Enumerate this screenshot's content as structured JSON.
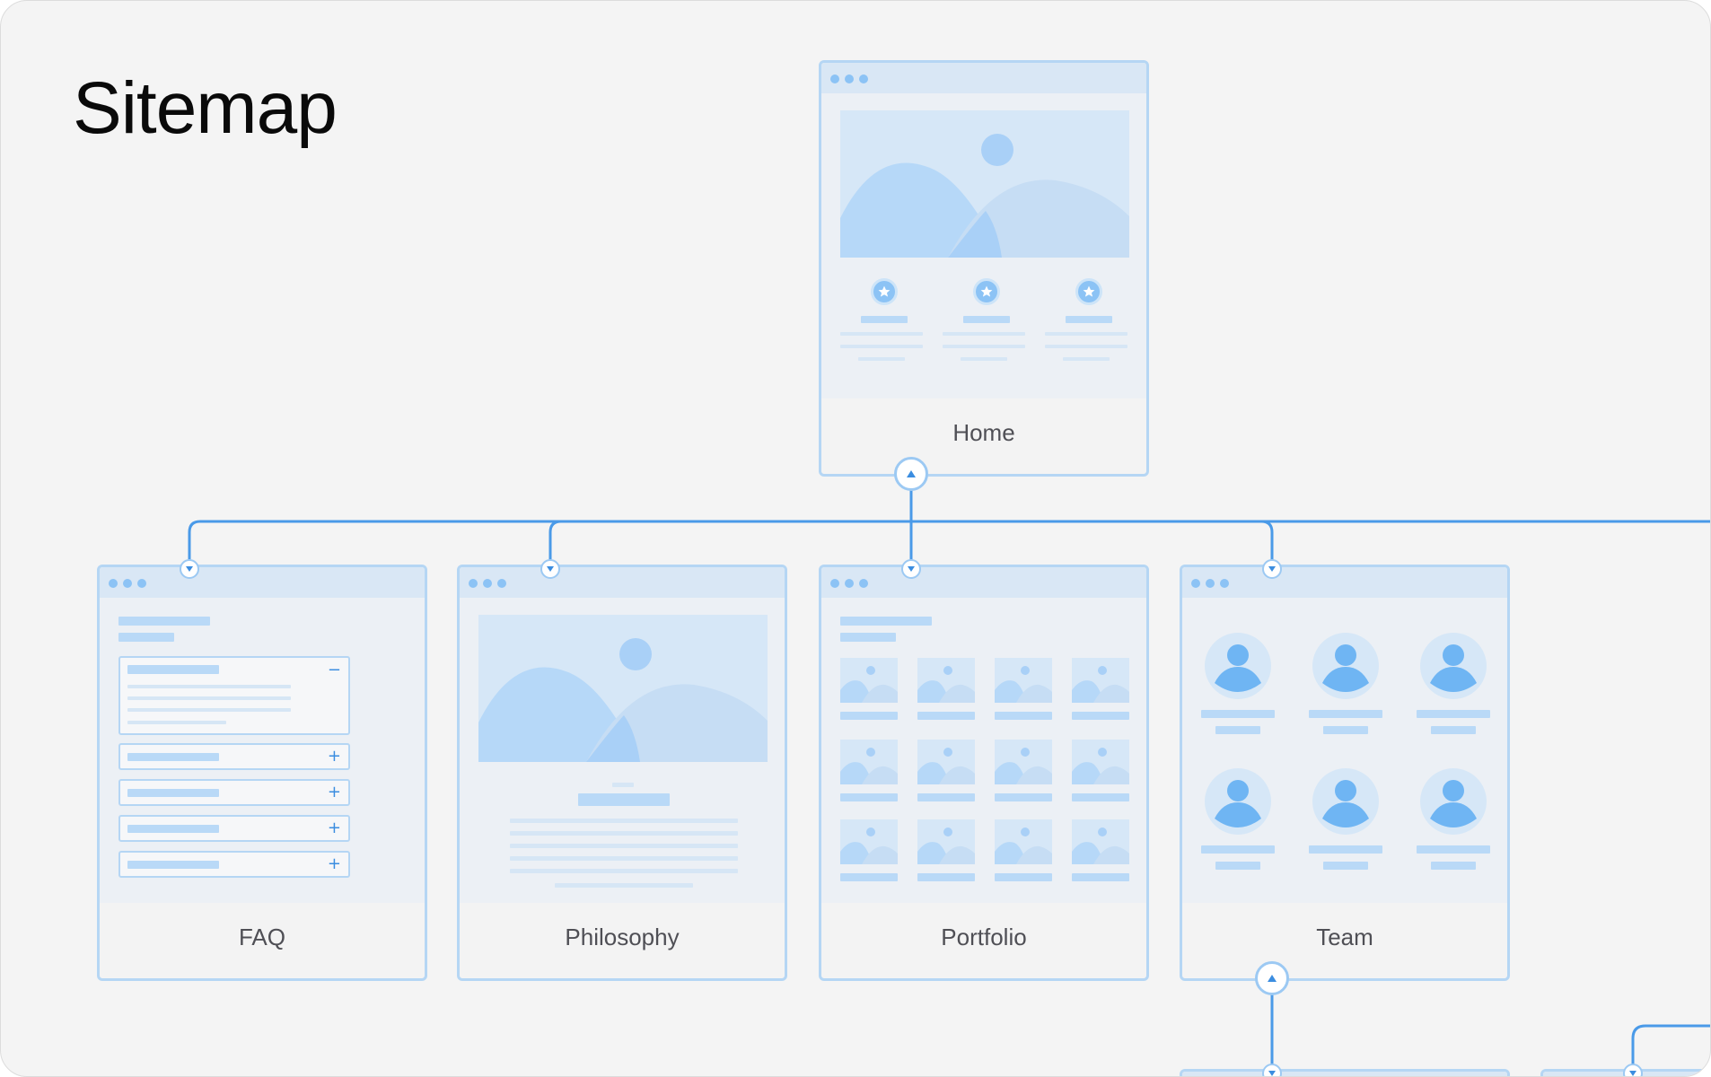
{
  "page": {
    "title": "Sitemap"
  },
  "cards": {
    "home": {
      "label": "Home"
    },
    "faq": {
      "label": "FAQ"
    },
    "philosophy": {
      "label": "Philosophy"
    },
    "portfolio": {
      "label": "Portfolio"
    },
    "team": {
      "label": "Team"
    }
  },
  "faq_accordion": {
    "expanded_symbol": "−",
    "collapsed_symbol": "+"
  },
  "colors": {
    "canvas_bg": "#f4f4f4",
    "card_border": "#b5d6f4",
    "card_header": "#d9e7f5",
    "connector": "#4a9ae8",
    "placeholder": "#b9d9f7",
    "accent": "#3b8de0"
  },
  "icons": [
    "window-dots-icon",
    "image-placeholder-icon",
    "star-badge-icon",
    "user-avatar-icon",
    "collapse-node-icon",
    "expand-node-icon"
  ]
}
